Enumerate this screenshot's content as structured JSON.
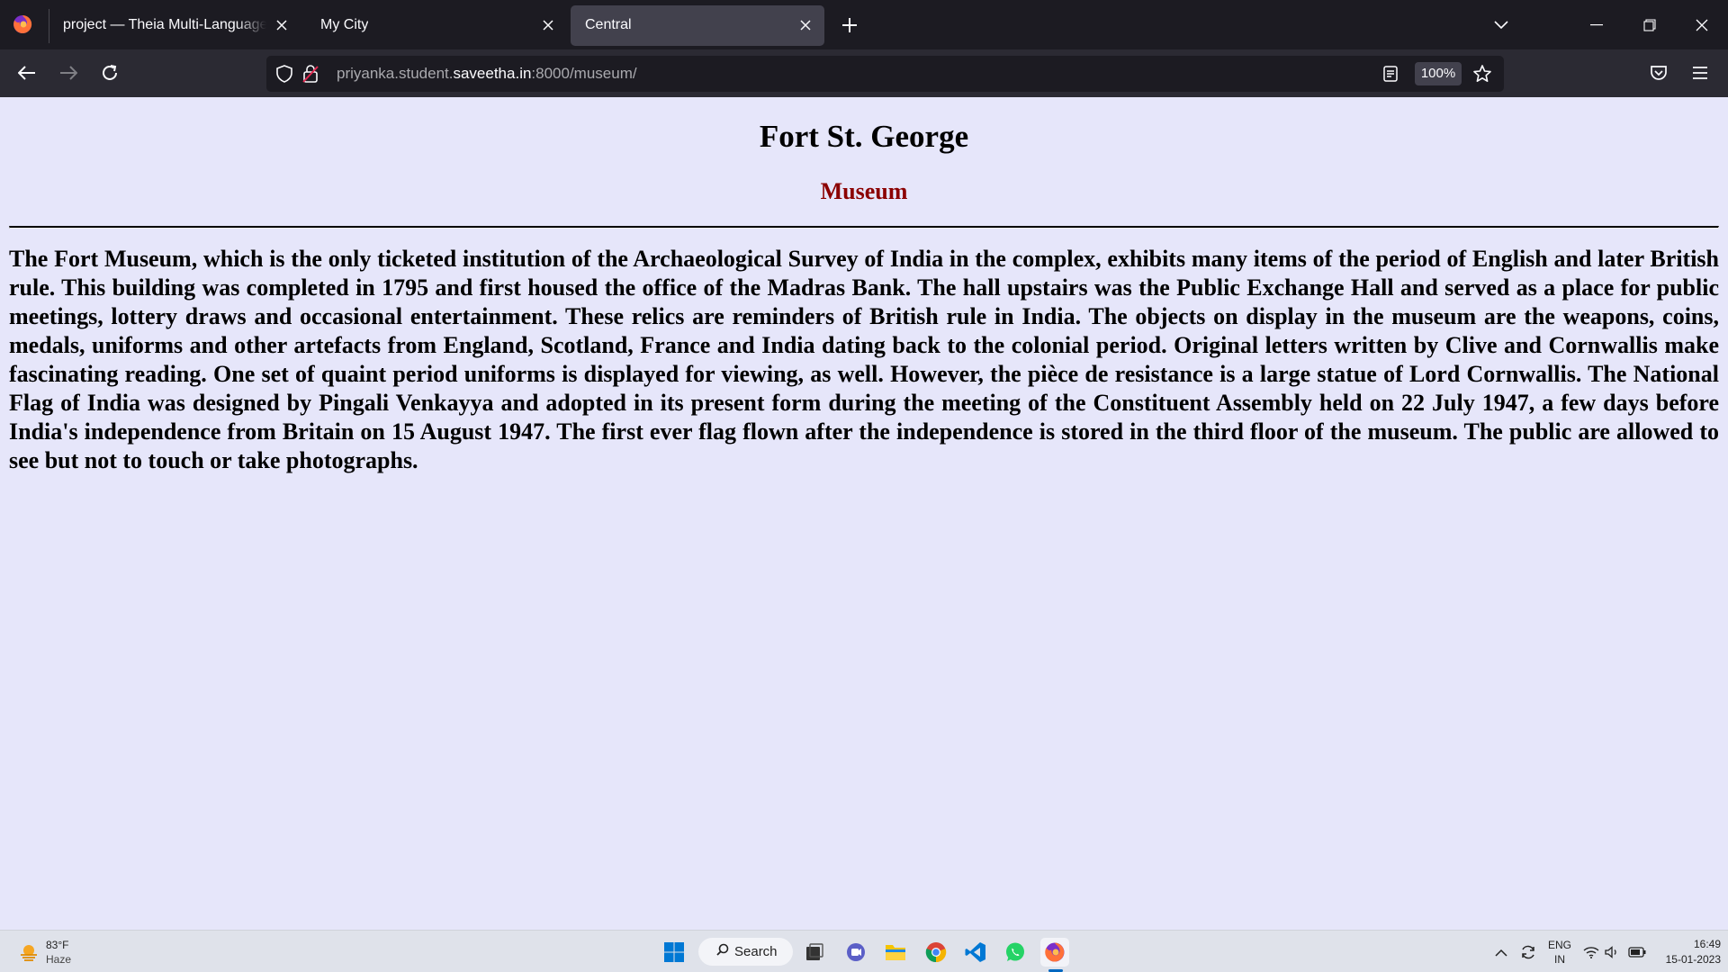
{
  "browser": {
    "tabs": [
      {
        "title": "project — Theia Multi-Language Exa",
        "active": false
      },
      {
        "title": "My City",
        "active": false
      },
      {
        "title": "Central",
        "active": true
      }
    ],
    "new_tab_label": "+",
    "address": {
      "prefix": "priyanka.student.",
      "host": "saveetha.in",
      "suffix": ":8000/museum/"
    },
    "zoom": "100%"
  },
  "page": {
    "title": "Fort St. George",
    "subtitle": "Museum",
    "subtitle_color": "#8b0000",
    "background_color": "#e6e6fa",
    "body": "The Fort Museum, which is the only ticketed institution of the Archaeological Survey of India in the complex, exhibits many items of the period of English and later British rule. This building was completed in 1795 and first housed the office of the Madras Bank. The hall upstairs was the Public Exchange Hall and served as a place for public meetings, lottery draws and occasional entertainment. These relics are reminders of British rule in India. The objects on display in the museum are the weapons, coins, medals, uniforms and other artefacts from England, Scotland, France and India dating back to the colonial period. Original letters written by Clive and Cornwallis make fascinating reading. One set of quaint period uniforms is displayed for viewing, as well. However, the pièce de resistance is a large statue of Lord Cornwallis. The National Flag of India was designed by Pingali Venkayya and adopted in its present form during the meeting of the Constituent Assembly held on 22 July 1947, a few days before India's independence from Britain on 15 August 1947. The first ever flag flown after the independence is stored in the third floor of the museum. The public are allowed to see but not to touch or take photographs."
  },
  "taskbar": {
    "weather_temp": "83°F",
    "weather_desc": "Haze",
    "search_label": "Search",
    "apps": [
      "start-icon",
      "file-explorer-icon",
      "teams-chat-icon",
      "folder-icon",
      "chrome-icon",
      "vscode-icon",
      "whatsapp-icon",
      "firefox-icon"
    ],
    "lang_top": "ENG",
    "lang_bottom": "IN",
    "time": "16:49",
    "date": "15-01-2023"
  }
}
